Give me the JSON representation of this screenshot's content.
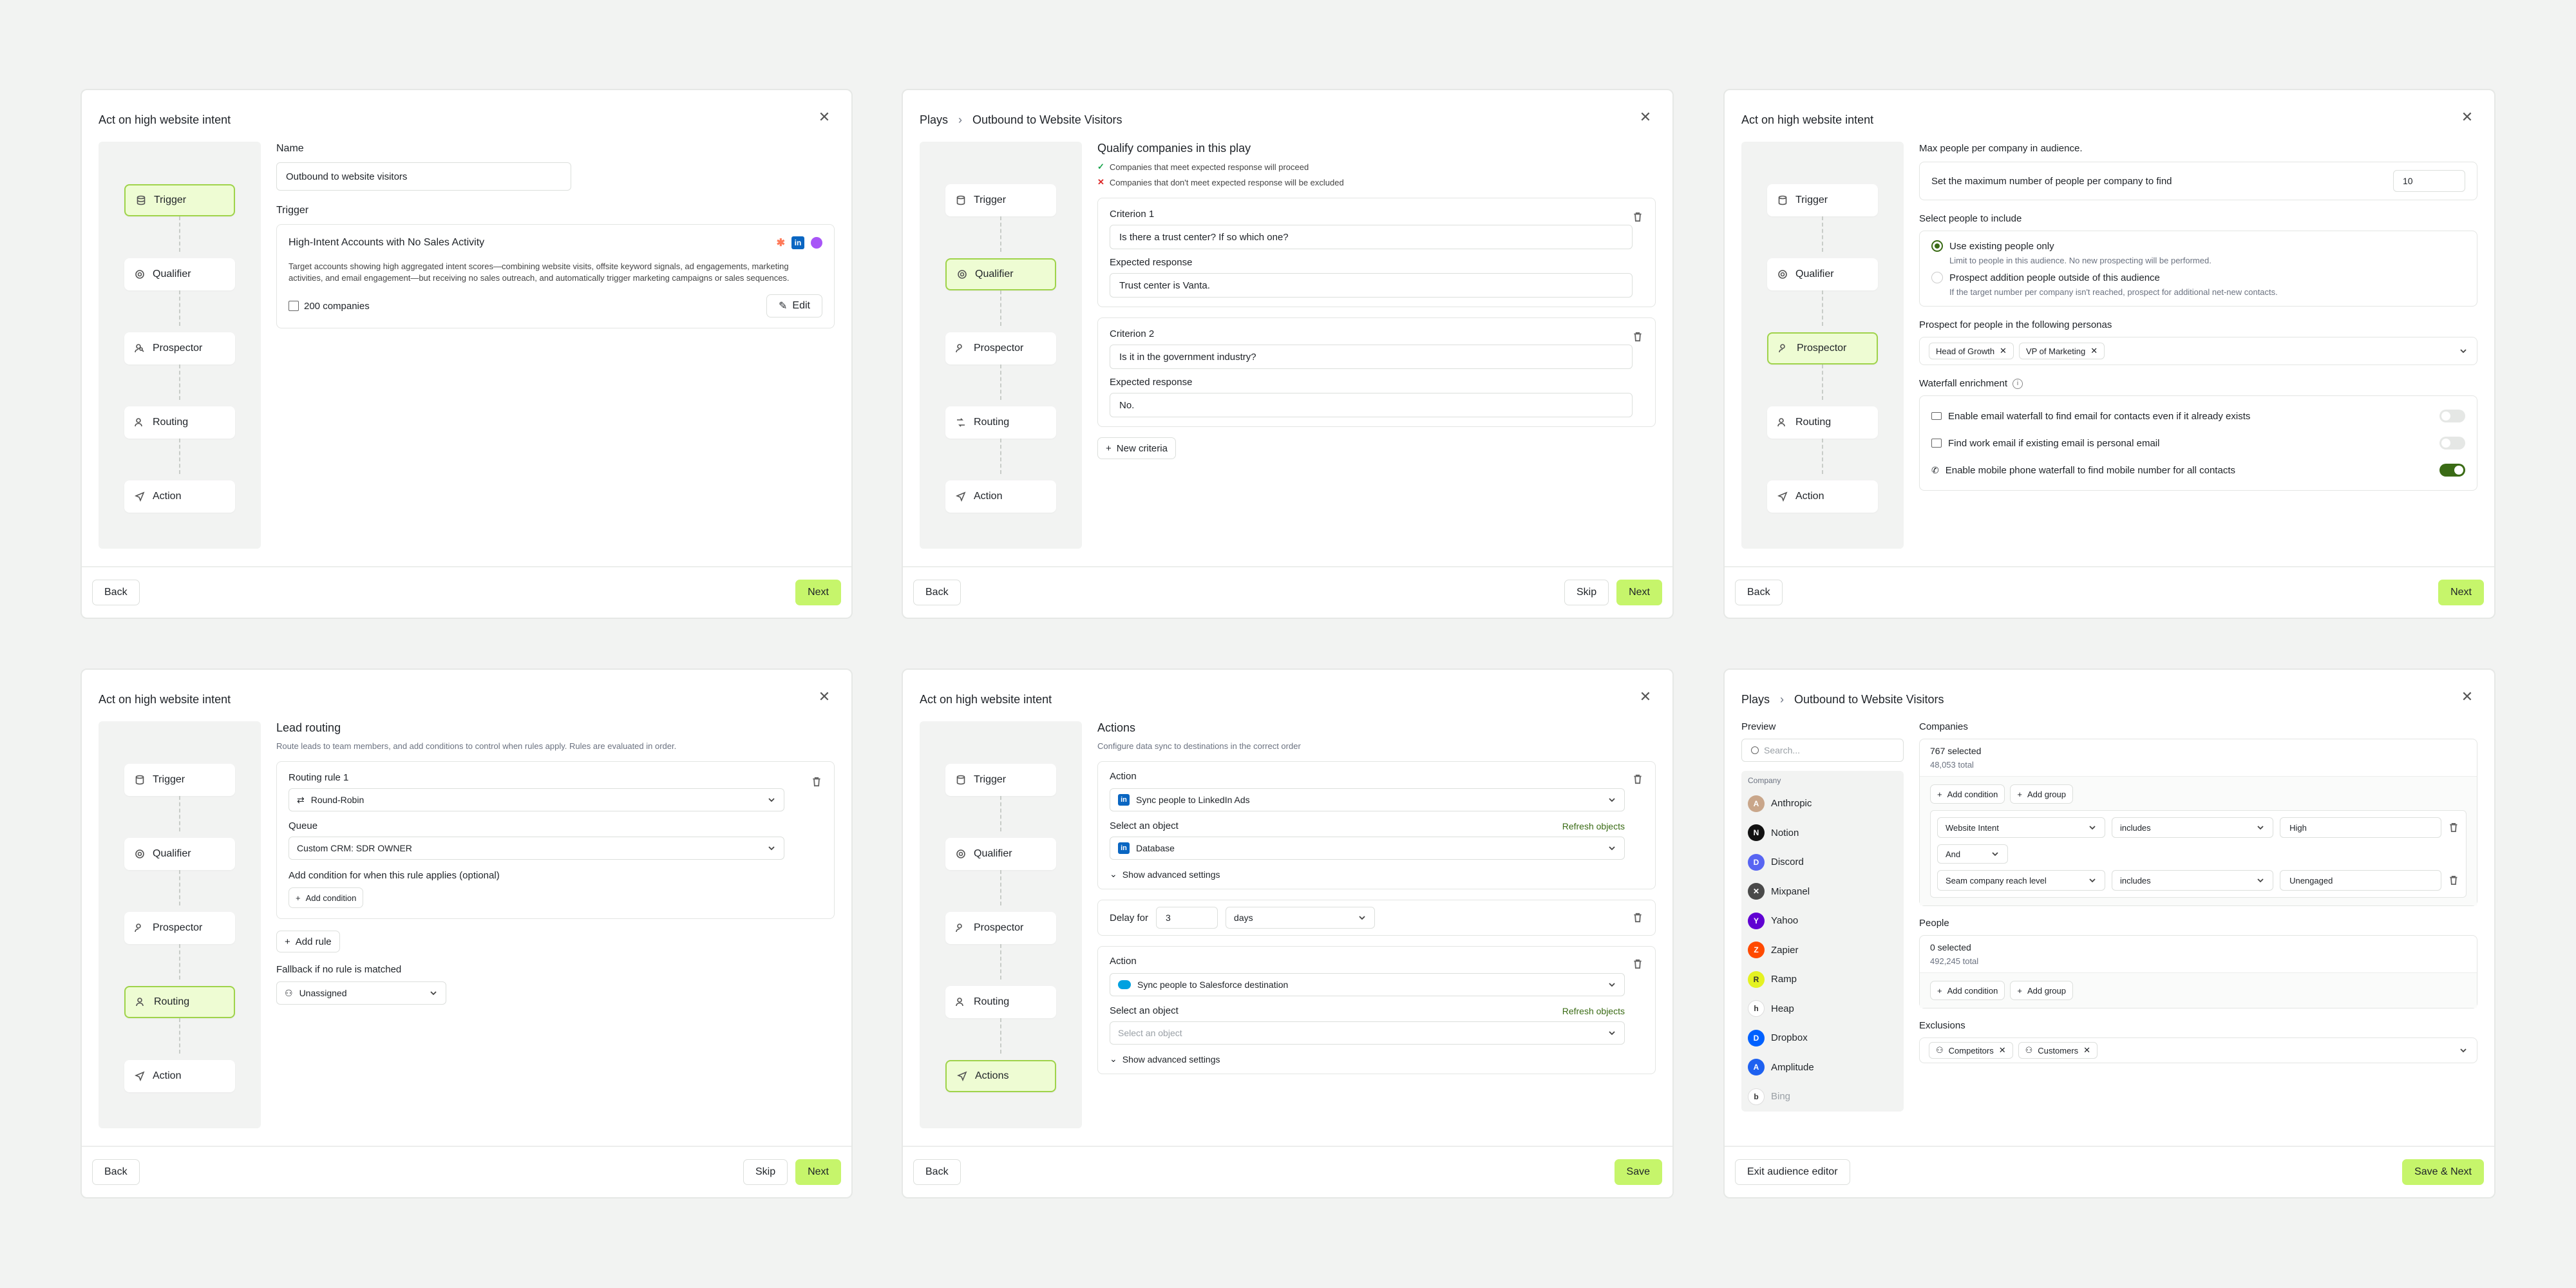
{
  "steps_common": {
    "trigger": "Trigger",
    "qualifier": "Qualifier",
    "prospector": "Prospector",
    "routing": "Routing",
    "action": "Action",
    "actions": "Actions"
  },
  "panel1": {
    "title": "Act on high website intent",
    "name_label": "Name",
    "name_value": "Outbound to website visitors",
    "trigger_label": "Trigger",
    "trigger_title": "High-Intent Accounts with No Sales Activity",
    "trigger_desc": "Target accounts showing high aggregated intent scores—combining website visits, offsite keyword signals, ad engagements, marketing activities, and email engagement—but receiving no sales outreach, and automatically trigger marketing campaigns or sales sequences.",
    "companies": "200 companies",
    "edit": "Edit",
    "back": "Back",
    "next": "Next"
  },
  "panel2": {
    "crumb1": "Plays",
    "crumb2": "Outbound to Website Visitors",
    "heading": "Qualify companies in this play",
    "note_ok": "Companies that meet expected response will proceed",
    "note_bad": "Companies that don't meet expected response will be excluded",
    "criteria": [
      {
        "label": "Criterion 1",
        "question": "Is there a trust center? If so which one?",
        "exp_label": "Expected response",
        "expected": "Trust center is Vanta."
      },
      {
        "label": "Criterion 2",
        "question": "Is it in the government industry?",
        "exp_label": "Expected response",
        "expected": "No."
      }
    ],
    "new_criteria": "New criteria",
    "back": "Back",
    "skip": "Skip",
    "next": "Next"
  },
  "panel3": {
    "title": "Act on high website intent",
    "max_label": "Max people per company in audience.",
    "max_text": "Set the maximum number of people per company to find",
    "max_value": "10",
    "select_label": "Select people to include",
    "opt1": "Use existing people only",
    "opt1_sub": "Limit to people in this audience. No new prospecting will be performed.",
    "opt2": "Prospect addition people outside of this audience",
    "opt2_sub": "If the target number per company isn't reached, prospect for additional net-new contacts.",
    "persona_label": "Prospect for people in the following personas",
    "personas": [
      "Head of Growth",
      "VP of Marketing"
    ],
    "waterfall_label": "Waterfall enrichment",
    "wf": [
      {
        "text": "Enable email waterfall to find email for contacts even if it already exists",
        "on": false
      },
      {
        "text": "Find work email if existing email is personal email",
        "on": false
      },
      {
        "text": "Enable mobile phone waterfall to find mobile number for all contacts",
        "on": true
      }
    ],
    "back": "Back",
    "next": "Next"
  },
  "panel4": {
    "title": "Act on high website intent",
    "heading": "Lead routing",
    "sub": "Route leads to team members, and add conditions to control when rules apply. Rules are evaluated in order.",
    "rule_label": "Routing rule 1",
    "rule_value": "Round-Robin",
    "queue_label": "Queue",
    "queue_value": "Custom CRM: SDR OWNER",
    "cond_label": "Add condition for when this rule applies (optional)",
    "add_condition": "Add condition",
    "add_rule": "Add rule",
    "fallback_label": "Fallback if no rule is matched",
    "fallback_value": "Unassigned",
    "back": "Back",
    "skip": "Skip",
    "next": "Next"
  },
  "panel5": {
    "title": "Act on high website intent",
    "heading": "Actions",
    "sub": "Configure data sync to destinations in the correct order",
    "action_label": "Action",
    "action1": "Sync people to LinkedIn Ads",
    "select_object": "Select an object",
    "refresh": "Refresh objects",
    "object1": "Database",
    "advanced": "Show advanced settings",
    "delay_label": "Delay for",
    "delay_value": "3",
    "delay_unit": "days",
    "action2": "Sync people to Salesforce destination",
    "object2_placeholder": "Select an object",
    "back": "Back",
    "save": "Save"
  },
  "panel6": {
    "crumb1": "Plays",
    "crumb2": "Outbound to Website Visitors",
    "preview": "Preview",
    "search_placeholder": "Search...",
    "company_col": "Company",
    "companies_list": [
      {
        "name": "Anthropic",
        "color": "#c9a68a",
        "glyph": "A"
      },
      {
        "name": "Notion",
        "color": "#111111",
        "glyph": "N"
      },
      {
        "name": "Discord",
        "color": "#5865f2",
        "glyph": "D"
      },
      {
        "name": "Mixpanel",
        "color": "#4a4a4a",
        "glyph": "✕"
      },
      {
        "name": "Yahoo",
        "color": "#6001d2",
        "glyph": "Y"
      },
      {
        "name": "Zapier",
        "color": "#ff4a00",
        "glyph": "Z"
      },
      {
        "name": "Ramp",
        "color": "#e4f222",
        "glyph": "R"
      },
      {
        "name": "Heap",
        "color": "#ffffff",
        "glyph": "h"
      },
      {
        "name": "Dropbox",
        "color": "#0061ff",
        "glyph": "D"
      },
      {
        "name": "Amplitude",
        "color": "#1e61f0",
        "glyph": "A"
      },
      {
        "name": "Bing",
        "color": "#ffffff",
        "glyph": "b"
      }
    ],
    "companies_label": "Companies",
    "comp_selected": "767 selected",
    "comp_total": "48,053 total",
    "add_condition": "Add condition",
    "add_group": "Add group",
    "cond1": {
      "field": "Website Intent",
      "op": "includes",
      "value": "High"
    },
    "and": "And",
    "cond2": {
      "field": "Seam company reach level",
      "op": "includes",
      "value": "Unengaged"
    },
    "people_label": "People",
    "people_selected": "0 selected",
    "people_total": "492,245 total",
    "exclusions_label": "Exclusions",
    "exclusions": [
      "Competitors",
      "Customers"
    ],
    "exit": "Exit audience editor",
    "save_next": "Save & Next"
  }
}
